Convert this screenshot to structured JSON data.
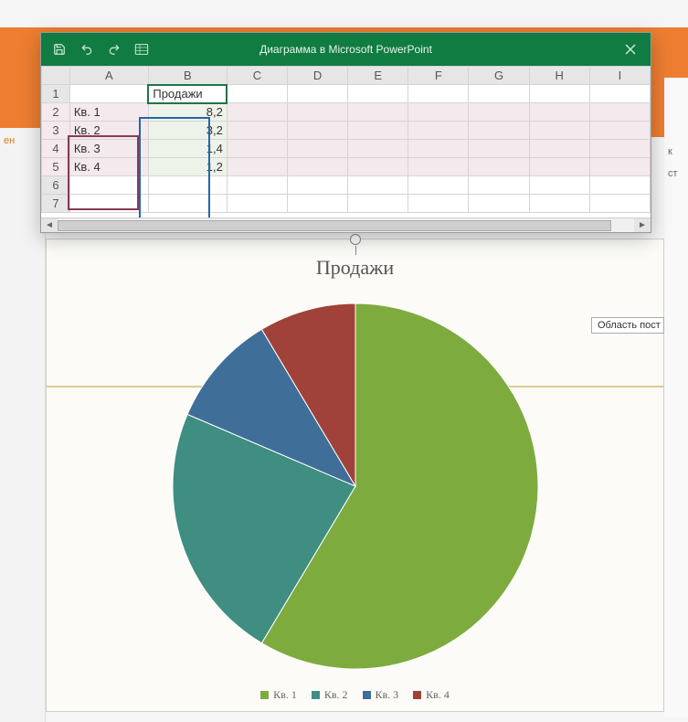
{
  "ppt": {
    "side_left_text": "ен",
    "side_right_text": "к\n\nст"
  },
  "window": {
    "title": "Диаграмма в Microsoft PowerPoint"
  },
  "sheet": {
    "columns": [
      "A",
      "B",
      "C",
      "D",
      "E",
      "F",
      "G",
      "H",
      "I"
    ],
    "row_numbers": [
      "1",
      "2",
      "3",
      "4",
      "5",
      "6",
      "7"
    ],
    "header_label": "Продажи",
    "rows": [
      {
        "cat": "Кв. 1",
        "val": "8,2"
      },
      {
        "cat": "Кв. 2",
        "val": "3,2"
      },
      {
        "cat": "Кв. 3",
        "val": "1,4"
      },
      {
        "cat": "Кв. 4",
        "val": "1,2"
      }
    ]
  },
  "chart": {
    "title": "Продажи",
    "tooltip": "Область пост",
    "legend": [
      {
        "label": "Кв. 1",
        "color": "#7eab3e"
      },
      {
        "label": "Кв. 2",
        "color": "#3f8e81"
      },
      {
        "label": "Кв. 3",
        "color": "#3f6e99"
      },
      {
        "label": "Кв. 4",
        "color": "#a04239"
      }
    ]
  },
  "chart_data": {
    "type": "pie",
    "title": "Продажи",
    "categories": [
      "Кв. 1",
      "Кв. 2",
      "Кв. 3",
      "Кв. 4"
    ],
    "values": [
      8.2,
      3.2,
      1.4,
      1.2
    ],
    "colors": [
      "#7eab3e",
      "#3f8e81",
      "#3f6e99",
      "#a04239"
    ]
  }
}
